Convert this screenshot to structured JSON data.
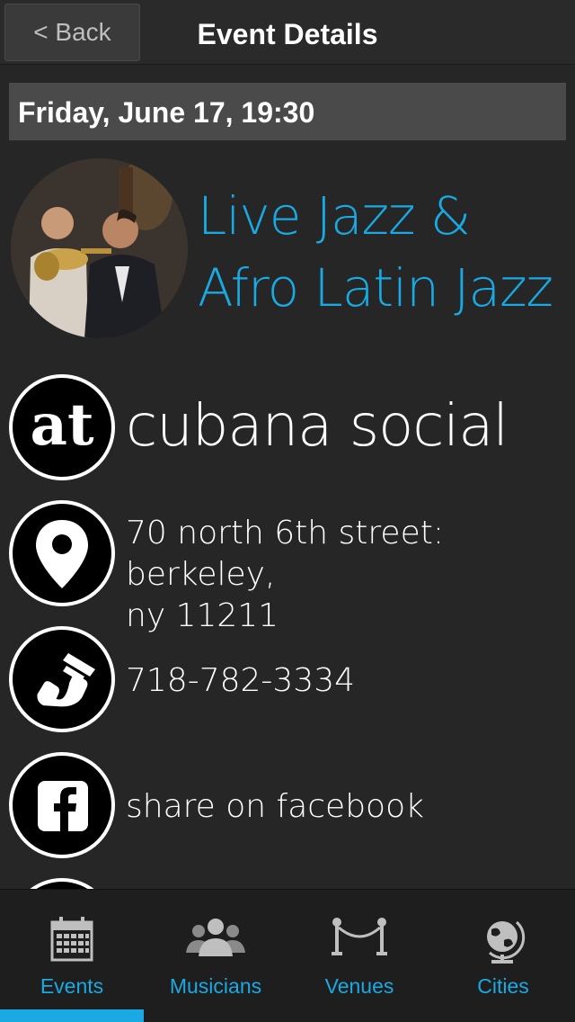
{
  "nav": {
    "back_label": "< Back",
    "title": "Event Details"
  },
  "event": {
    "date_time": "Friday, June 17, 19:30",
    "title_line1": "Live Jazz &",
    "title_line2": "Afro Latin Jazz"
  },
  "details": {
    "venue_icon_text": "at",
    "venue_name": "cubana social",
    "address_line1": "70 north 6th street: berkeley,",
    "address_line2": "ny 11211",
    "phone": "718-782-3334",
    "share_label": "share on facebook"
  },
  "tabs": [
    {
      "label": "Events",
      "icon": "calendar-icon",
      "selected": true
    },
    {
      "label": "Musicians",
      "icon": "people-icon",
      "selected": false
    },
    {
      "label": "Venues",
      "icon": "rope-barrier-icon",
      "selected": false
    },
    {
      "label": "Cities",
      "icon": "globe-icon",
      "selected": false
    }
  ],
  "colors": {
    "accent": "#19a9e3",
    "background": "#262626",
    "date_bar": "#4a4a4a",
    "tabbar": "#1e1e1e"
  }
}
